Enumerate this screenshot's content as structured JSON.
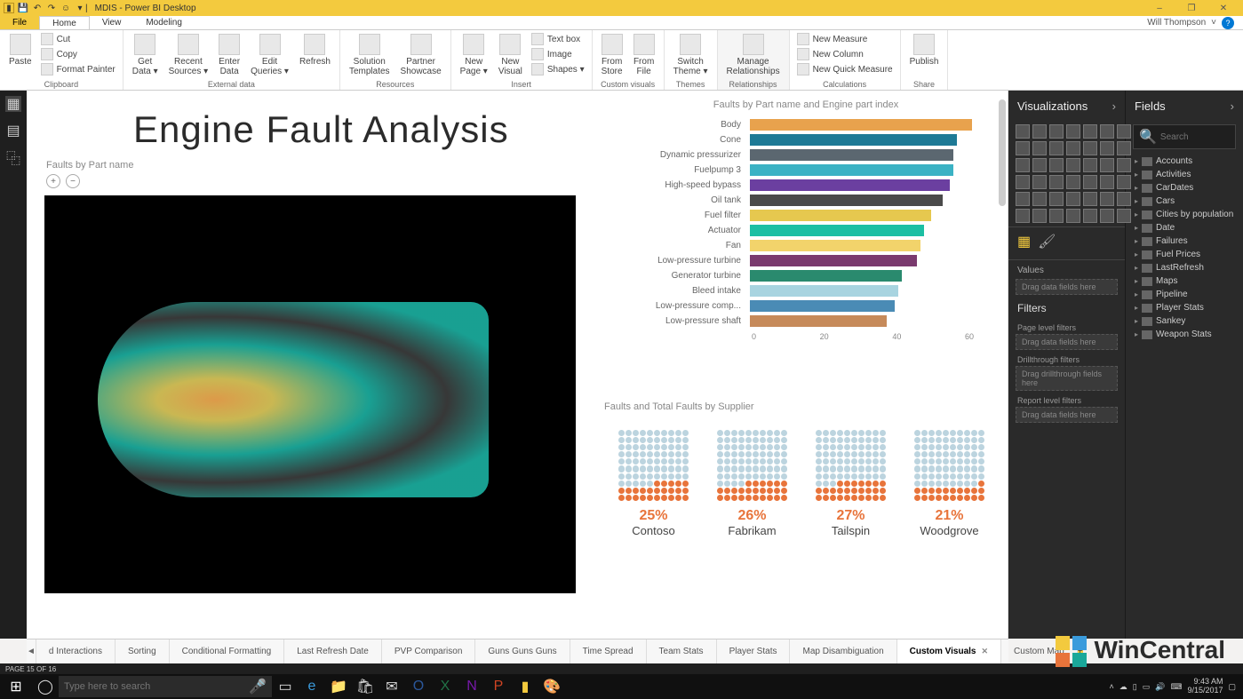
{
  "app": {
    "title": "MDIS - Power BI Desktop",
    "user": "Will Thompson"
  },
  "window": {
    "minimize": "–",
    "maximize": "❐",
    "close": "✕"
  },
  "menutabs": {
    "file": "File",
    "home": "Home",
    "view": "View",
    "modeling": "Modeling"
  },
  "ribbon": {
    "clipboard": {
      "label": "Clipboard",
      "paste": "Paste",
      "cut": "Cut",
      "copy": "Copy",
      "format_painter": "Format Painter"
    },
    "external": {
      "label": "External data",
      "get_data": "Get\nData ▾",
      "recent": "Recent\nSources ▾",
      "enter": "Enter\nData",
      "edit_q": "Edit\nQueries ▾",
      "refresh": "Refresh"
    },
    "resources": {
      "label": "Resources",
      "solution": "Solution\nTemplates",
      "partner": "Partner\nShowcase"
    },
    "insert": {
      "label": "Insert",
      "new_page": "New\nPage ▾",
      "new_visual": "New\nVisual",
      "textbox": "Text box",
      "image": "Image",
      "shapes": "Shapes ▾"
    },
    "custom": {
      "label": "Custom visuals",
      "from_store": "From\nStore",
      "from_file": "From\nFile"
    },
    "themes": {
      "label": "Themes",
      "switch": "Switch\nTheme ▾"
    },
    "relationships": {
      "label": "Relationships",
      "manage": "Manage\nRelationships"
    },
    "calculations": {
      "label": "Calculations",
      "new_measure": "New Measure",
      "new_column": "New Column",
      "new_quick": "New Quick Measure"
    },
    "share": {
      "label": "Share",
      "publish": "Publish"
    }
  },
  "report": {
    "title": "Engine Fault Analysis",
    "faults_by_part_label": "Faults by Part name",
    "bar_title": "Faults by Part name and Engine part index",
    "supplier_title": "Faults and Total Faults by Supplier"
  },
  "chart_data": {
    "bar": {
      "type": "bar",
      "orientation": "horizontal",
      "xlim": [
        0,
        60
      ],
      "xticks": [
        0,
        20,
        40,
        60
      ],
      "series": [
        {
          "label": "Body",
          "value": 60,
          "color": "#e8a24d"
        },
        {
          "label": "Cone",
          "value": 56,
          "color": "#1e7a96"
        },
        {
          "label": "Dynamic pressurizer",
          "value": 55,
          "color": "#5b6770"
        },
        {
          "label": "Fuelpump 3",
          "value": 55,
          "color": "#3bb2c4"
        },
        {
          "label": "High-speed bypass",
          "value": 54,
          "color": "#6b3fa0"
        },
        {
          "label": "Oil tank",
          "value": 52,
          "color": "#4a4a4a"
        },
        {
          "label": "Fuel filter",
          "value": 49,
          "color": "#e6c84f"
        },
        {
          "label": "Actuator",
          "value": 47,
          "color": "#1cbfa3"
        },
        {
          "label": "Fan",
          "value": 46,
          "color": "#f2d36b"
        },
        {
          "label": "Low-pressure turbine",
          "value": 45,
          "color": "#7a3a6e"
        },
        {
          "label": "Generator turbine",
          "value": 41,
          "color": "#2a8a6e"
        },
        {
          "label": "Bleed intake",
          "value": 40,
          "color": "#a8d4e0"
        },
        {
          "label": "Low-pressure comp...",
          "value": 39,
          "color": "#4a8bb5"
        },
        {
          "label": "Low-pressure shaft",
          "value": 37,
          "color": "#c68a5a"
        }
      ]
    },
    "suppliers": {
      "type": "waffle",
      "items": [
        {
          "name": "Contoso",
          "pct": 25,
          "label": "25%"
        },
        {
          "name": "Fabrikam",
          "pct": 26,
          "label": "26%"
        },
        {
          "name": "Tailspin",
          "pct": 27,
          "label": "27%"
        },
        {
          "name": "Woodgrove",
          "pct": 21,
          "label": "21%"
        }
      ]
    }
  },
  "viz_pane": {
    "title": "Visualizations",
    "values_label": "Values",
    "values_drop": "Drag data fields here",
    "filters_label": "Filters",
    "page_filters": "Page level filters",
    "page_drop": "Drag data fields here",
    "drill_filters": "Drillthrough filters",
    "drill_drop": "Drag drillthrough fields here",
    "report_filters": "Report level filters",
    "report_drop": "Drag data fields here"
  },
  "fields_pane": {
    "title": "Fields",
    "search_placeholder": "Search",
    "tables": [
      "Accounts",
      "Activities",
      "CarDates",
      "Cars",
      "Cities by population",
      "Date",
      "Failures",
      "Fuel Prices",
      "LastRefresh",
      "Maps",
      "Pipeline",
      "Player Stats",
      "Sankey",
      "Weapon Stats"
    ]
  },
  "page_tabs": {
    "prev": "◄",
    "items": [
      "d Interactions",
      "Sorting",
      "Conditional Formatting",
      "Last Refresh Date",
      "PVP Comparison",
      "Guns Guns Guns",
      "Time Spread",
      "Team Stats",
      "Player Stats",
      "Map Disambiguation",
      "Custom Visuals",
      "Custom Map"
    ],
    "active_index": 10,
    "add": "+"
  },
  "status": {
    "page": "PAGE 15 OF 16"
  },
  "taskbar": {
    "search_placeholder": "Type here to search",
    "time": "9:43 AM",
    "date": "9/15/2017"
  },
  "watermark": "WinCentral"
}
